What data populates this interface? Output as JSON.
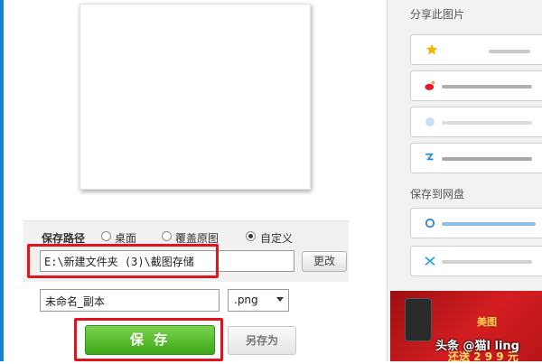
{
  "preview": {},
  "save_path": {
    "label": "保存路径",
    "options": [
      {
        "label": "桌面",
        "selected": false
      },
      {
        "label": "覆盖原图",
        "selected": false
      },
      {
        "label": "自定义",
        "selected": true
      }
    ],
    "path_value": "E:\\新建文件夹 (3)\\截图存储",
    "change_label": "更改"
  },
  "file": {
    "name_value": "未命名_副本",
    "format_value": ".png"
  },
  "actions": {
    "save_label": "保 存",
    "save_as_label": "另存为"
  },
  "sidebar": {
    "share_title": "分享此图片",
    "cloud_title": "保存到网盘",
    "share_icons": [
      "star-icon",
      "weibo-icon",
      "qq-icon",
      "qzone-icon"
    ],
    "cloud_icons": [
      "baidu-cloud-icon",
      "cloud-drive-icon"
    ]
  },
  "ad": {
    "text_1": "美图",
    "text_2": "还送 2 9 9 元"
  },
  "watermark": "头条 @猫l ling",
  "colors": {
    "accent_green": "#3ea817",
    "highlight_red": "#e0141b",
    "sidebar_bg": "#f2f2f2"
  }
}
